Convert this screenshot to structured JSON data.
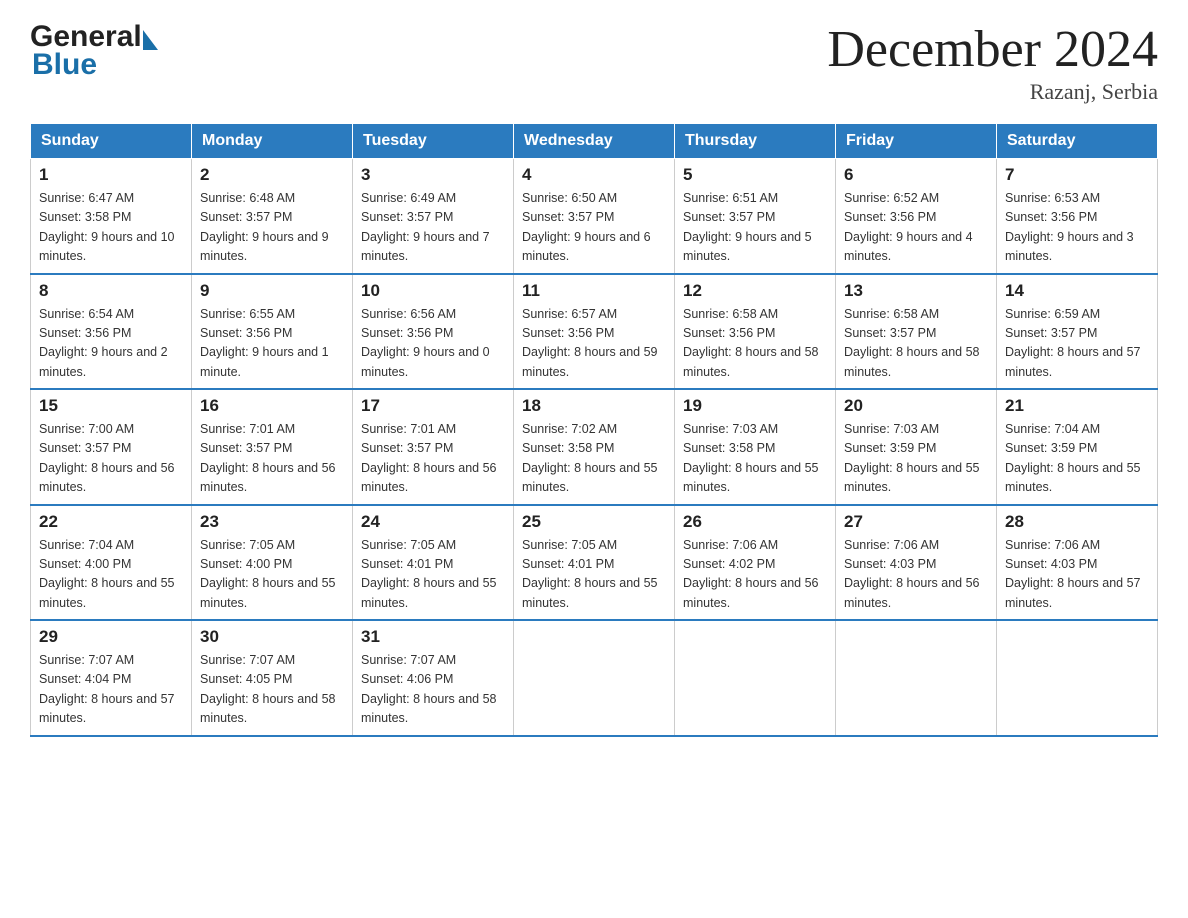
{
  "header": {
    "title": "December 2024",
    "subtitle": "Razanj, Serbia",
    "logo_general": "General",
    "logo_blue": "Blue"
  },
  "weekdays": [
    "Sunday",
    "Monday",
    "Tuesday",
    "Wednesday",
    "Thursday",
    "Friday",
    "Saturday"
  ],
  "weeks": [
    [
      {
        "day": "1",
        "sunrise": "6:47 AM",
        "sunset": "3:58 PM",
        "daylight": "9 hours and 10 minutes."
      },
      {
        "day": "2",
        "sunrise": "6:48 AM",
        "sunset": "3:57 PM",
        "daylight": "9 hours and 9 minutes."
      },
      {
        "day": "3",
        "sunrise": "6:49 AM",
        "sunset": "3:57 PM",
        "daylight": "9 hours and 7 minutes."
      },
      {
        "day": "4",
        "sunrise": "6:50 AM",
        "sunset": "3:57 PM",
        "daylight": "9 hours and 6 minutes."
      },
      {
        "day": "5",
        "sunrise": "6:51 AM",
        "sunset": "3:57 PM",
        "daylight": "9 hours and 5 minutes."
      },
      {
        "day": "6",
        "sunrise": "6:52 AM",
        "sunset": "3:56 PM",
        "daylight": "9 hours and 4 minutes."
      },
      {
        "day": "7",
        "sunrise": "6:53 AM",
        "sunset": "3:56 PM",
        "daylight": "9 hours and 3 minutes."
      }
    ],
    [
      {
        "day": "8",
        "sunrise": "6:54 AM",
        "sunset": "3:56 PM",
        "daylight": "9 hours and 2 minutes."
      },
      {
        "day": "9",
        "sunrise": "6:55 AM",
        "sunset": "3:56 PM",
        "daylight": "9 hours and 1 minute."
      },
      {
        "day": "10",
        "sunrise": "6:56 AM",
        "sunset": "3:56 PM",
        "daylight": "9 hours and 0 minutes."
      },
      {
        "day": "11",
        "sunrise": "6:57 AM",
        "sunset": "3:56 PM",
        "daylight": "8 hours and 59 minutes."
      },
      {
        "day": "12",
        "sunrise": "6:58 AM",
        "sunset": "3:56 PM",
        "daylight": "8 hours and 58 minutes."
      },
      {
        "day": "13",
        "sunrise": "6:58 AM",
        "sunset": "3:57 PM",
        "daylight": "8 hours and 58 minutes."
      },
      {
        "day": "14",
        "sunrise": "6:59 AM",
        "sunset": "3:57 PM",
        "daylight": "8 hours and 57 minutes."
      }
    ],
    [
      {
        "day": "15",
        "sunrise": "7:00 AM",
        "sunset": "3:57 PM",
        "daylight": "8 hours and 56 minutes."
      },
      {
        "day": "16",
        "sunrise": "7:01 AM",
        "sunset": "3:57 PM",
        "daylight": "8 hours and 56 minutes."
      },
      {
        "day": "17",
        "sunrise": "7:01 AM",
        "sunset": "3:57 PM",
        "daylight": "8 hours and 56 minutes."
      },
      {
        "day": "18",
        "sunrise": "7:02 AM",
        "sunset": "3:58 PM",
        "daylight": "8 hours and 55 minutes."
      },
      {
        "day": "19",
        "sunrise": "7:03 AM",
        "sunset": "3:58 PM",
        "daylight": "8 hours and 55 minutes."
      },
      {
        "day": "20",
        "sunrise": "7:03 AM",
        "sunset": "3:59 PM",
        "daylight": "8 hours and 55 minutes."
      },
      {
        "day": "21",
        "sunrise": "7:04 AM",
        "sunset": "3:59 PM",
        "daylight": "8 hours and 55 minutes."
      }
    ],
    [
      {
        "day": "22",
        "sunrise": "7:04 AM",
        "sunset": "4:00 PM",
        "daylight": "8 hours and 55 minutes."
      },
      {
        "day": "23",
        "sunrise": "7:05 AM",
        "sunset": "4:00 PM",
        "daylight": "8 hours and 55 minutes."
      },
      {
        "day": "24",
        "sunrise": "7:05 AM",
        "sunset": "4:01 PM",
        "daylight": "8 hours and 55 minutes."
      },
      {
        "day": "25",
        "sunrise": "7:05 AM",
        "sunset": "4:01 PM",
        "daylight": "8 hours and 55 minutes."
      },
      {
        "day": "26",
        "sunrise": "7:06 AM",
        "sunset": "4:02 PM",
        "daylight": "8 hours and 56 minutes."
      },
      {
        "day": "27",
        "sunrise": "7:06 AM",
        "sunset": "4:03 PM",
        "daylight": "8 hours and 56 minutes."
      },
      {
        "day": "28",
        "sunrise": "7:06 AM",
        "sunset": "4:03 PM",
        "daylight": "8 hours and 57 minutes."
      }
    ],
    [
      {
        "day": "29",
        "sunrise": "7:07 AM",
        "sunset": "4:04 PM",
        "daylight": "8 hours and 57 minutes."
      },
      {
        "day": "30",
        "sunrise": "7:07 AM",
        "sunset": "4:05 PM",
        "daylight": "8 hours and 58 minutes."
      },
      {
        "day": "31",
        "sunrise": "7:07 AM",
        "sunset": "4:06 PM",
        "daylight": "8 hours and 58 minutes."
      },
      null,
      null,
      null,
      null
    ]
  ],
  "labels": {
    "sunrise": "Sunrise:",
    "sunset": "Sunset:",
    "daylight": "Daylight:"
  }
}
